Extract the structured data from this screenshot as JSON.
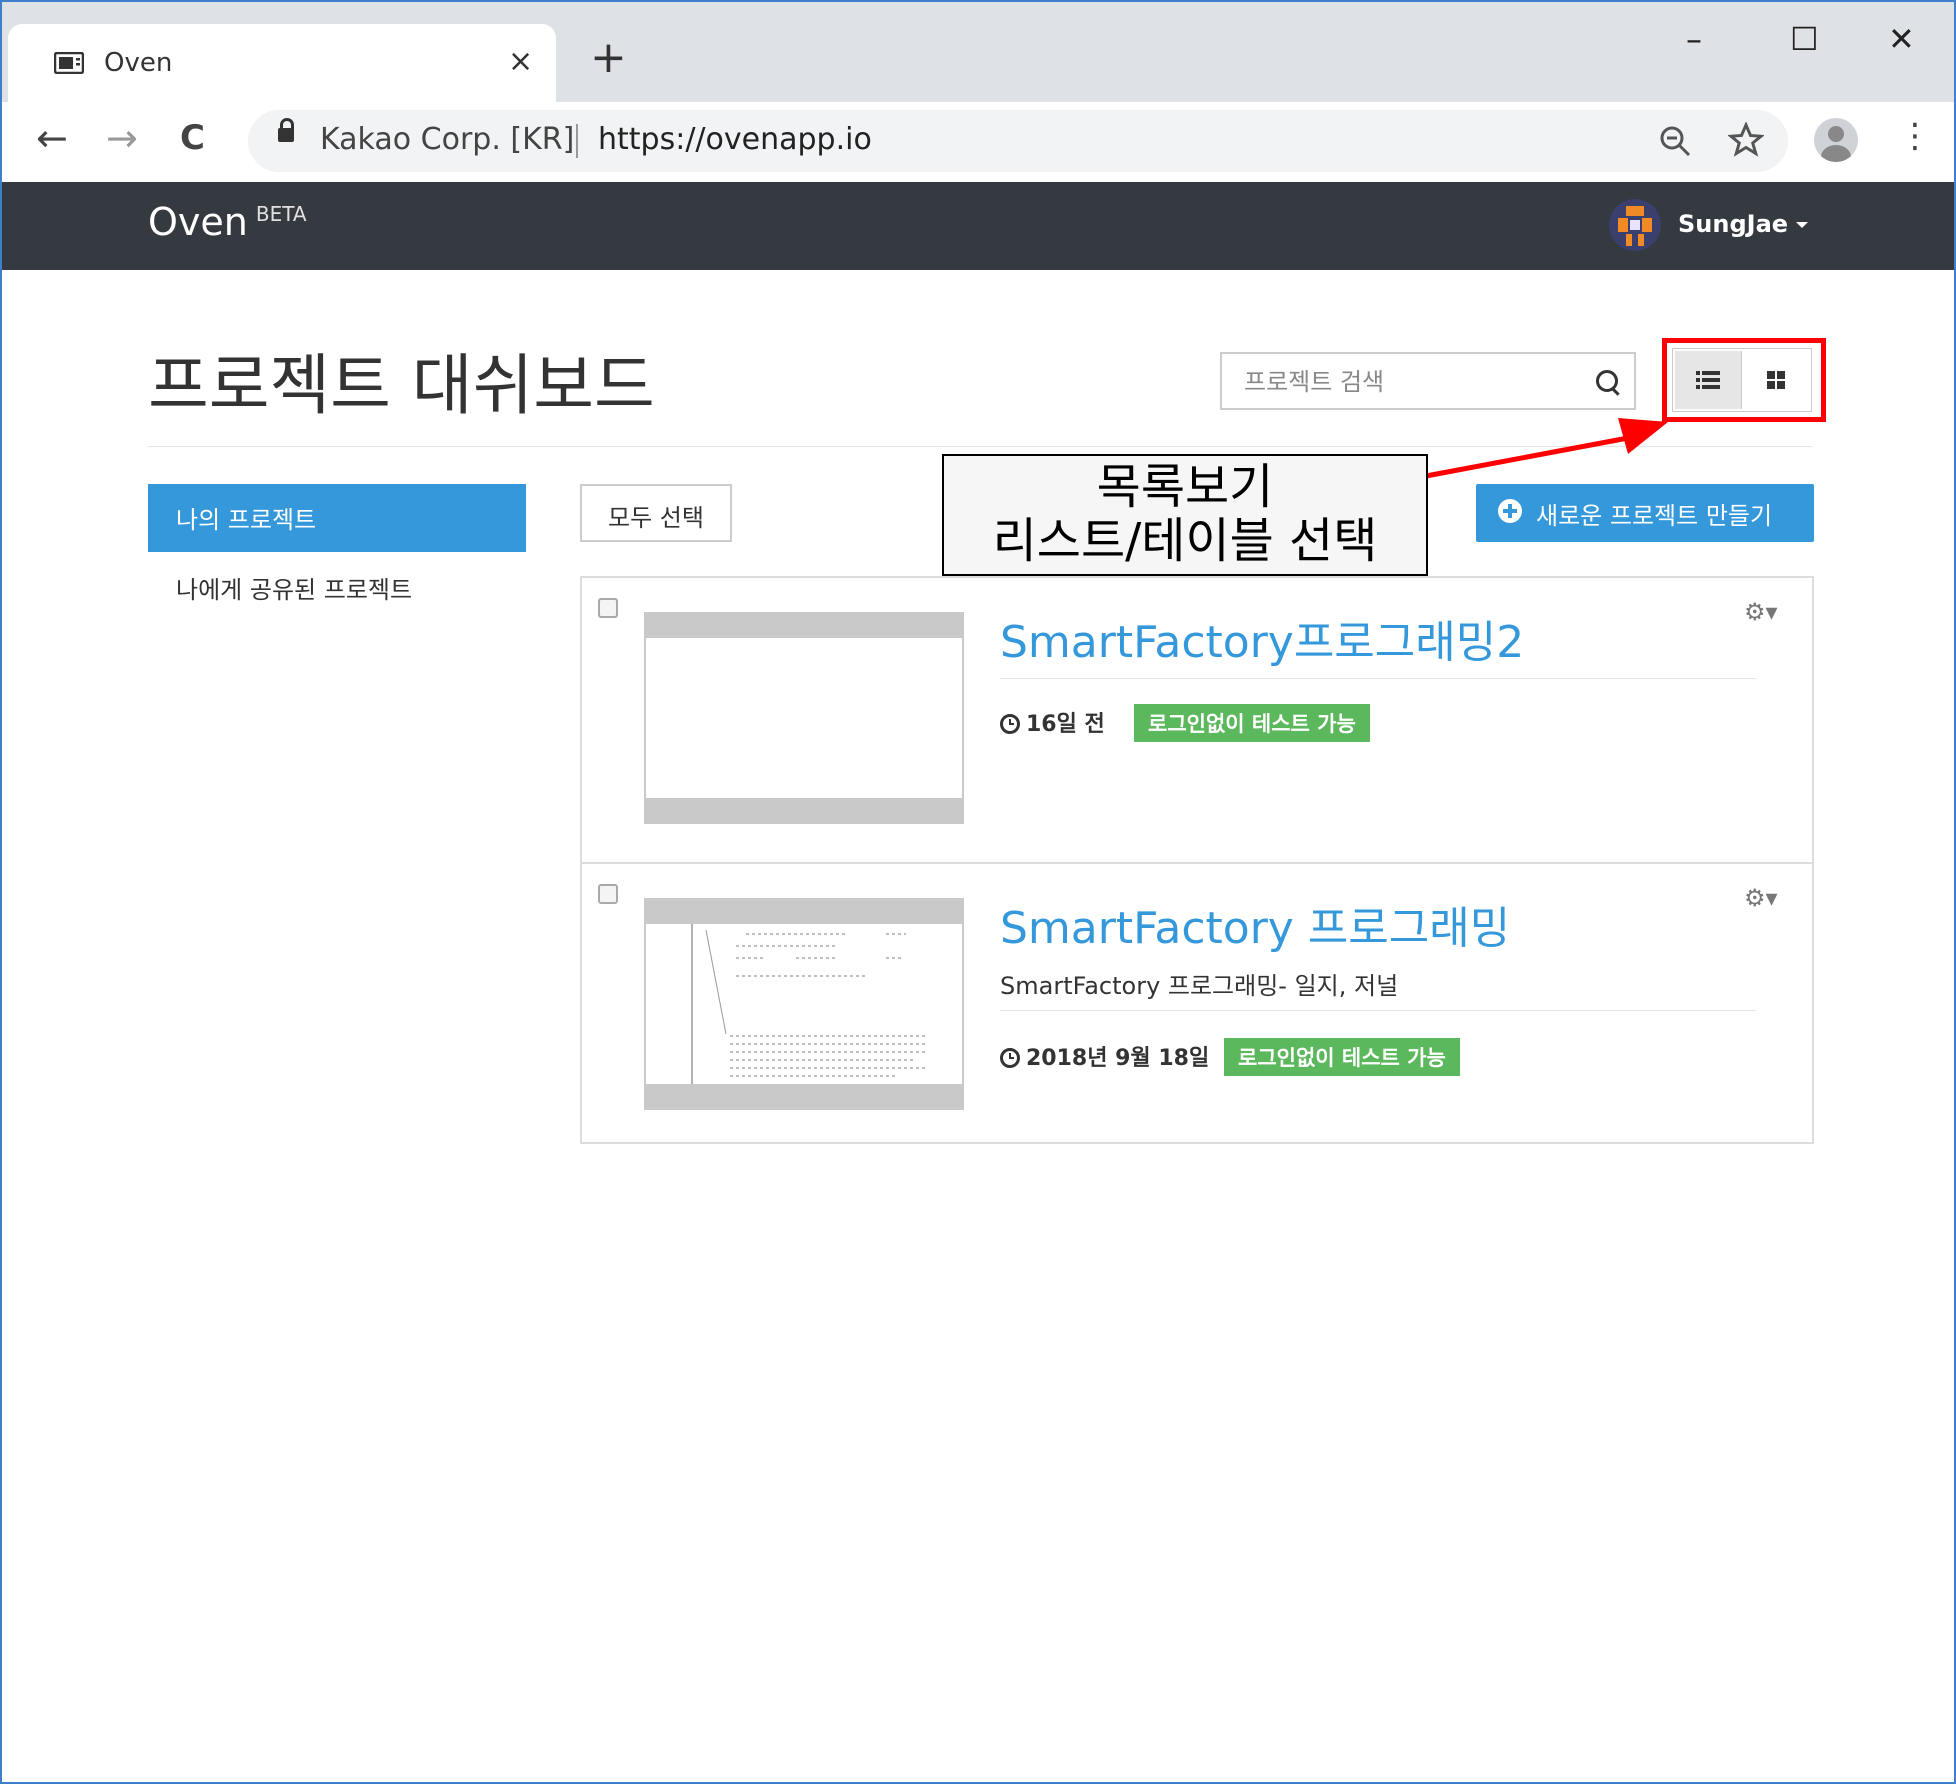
{
  "browser": {
    "tab_title": "Oven",
    "tab_close": "×",
    "new_tab": "+",
    "window_controls": {
      "minimize": "–",
      "maximize": "☐",
      "close": "✕"
    },
    "nav": {
      "back": "←",
      "forward": "→",
      "reload": "C"
    },
    "site_identity": "Kakao Corp. [KR]",
    "url": "https://ovenapp.io",
    "omnibox_icons": [
      "zoom-icon",
      "star-icon"
    ],
    "menu": "⋮"
  },
  "app": {
    "brand": "Oven",
    "brand_tag": "BETA",
    "user_name": "SungJae"
  },
  "page": {
    "title": "프로젝트 대쉬보드",
    "search_placeholder": "프로젝트 검색",
    "view_toggle": {
      "list_icon": "list-icon",
      "grid_icon": "grid-icon",
      "active": "list"
    },
    "sidebar": {
      "items": [
        {
          "label": "나의 프로젝트",
          "active": true
        },
        {
          "label": "나에게 공유된 프로젝트",
          "active": false
        }
      ]
    },
    "select_all": "모두 선택",
    "new_project": "새로운 프로젝트 만들기",
    "annotation": {
      "line1": "목록보기",
      "line2": "리스트/테이블 선택"
    },
    "projects": [
      {
        "name": "SmartFactory프로그래밍2",
        "description": "",
        "time": "16일 전",
        "badge": "로그인없이 테스트 가능"
      },
      {
        "name": "SmartFactory 프로그래밍",
        "description": "SmartFactory 프로그래밍- 일지, 저널",
        "time": "2018년 9월 18일",
        "badge": "로그인없이 테스트 가능"
      }
    ]
  },
  "colors": {
    "accent": "#3498db",
    "badge": "#5cb85c",
    "navbar": "#343a40",
    "annotation_red": "#ff0000"
  }
}
